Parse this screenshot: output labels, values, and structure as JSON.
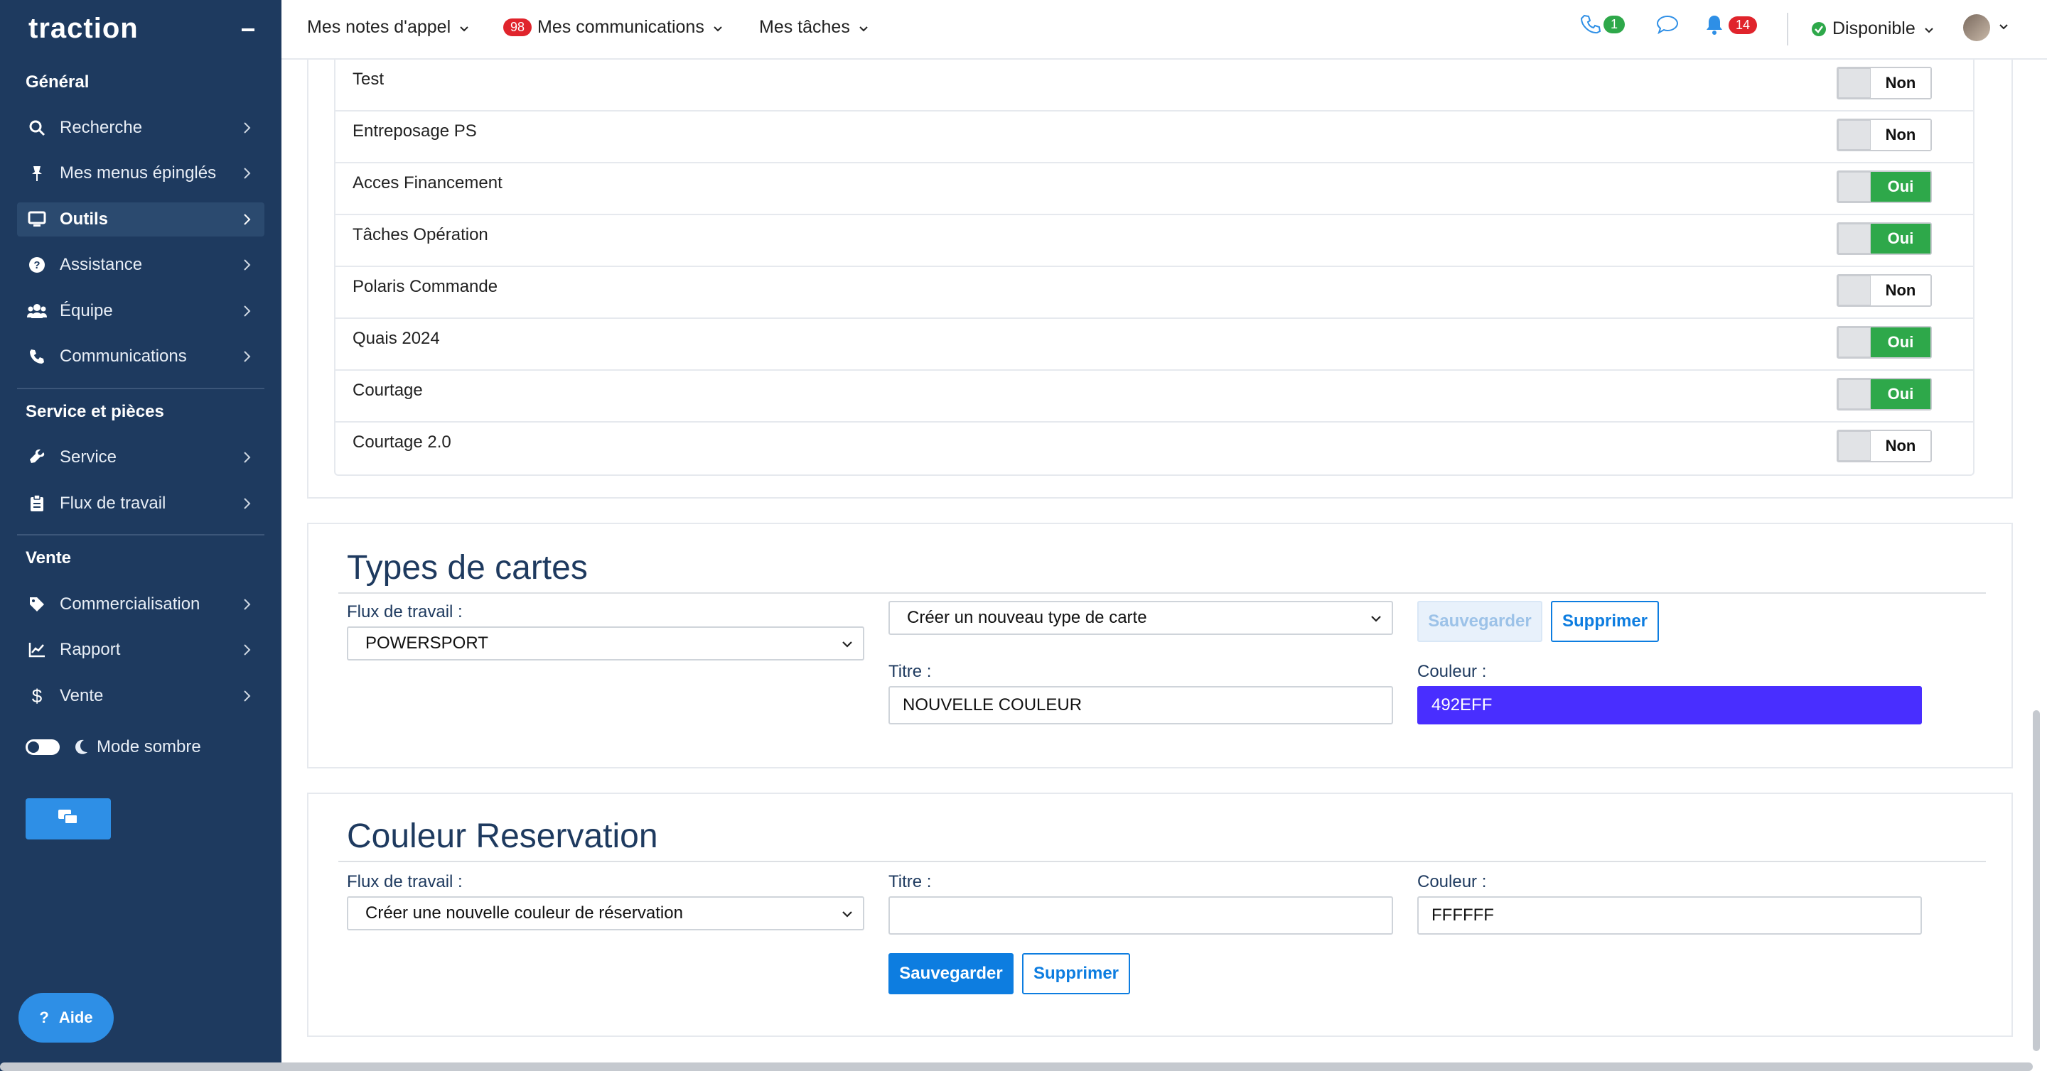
{
  "sidebar": {
    "logo": "traction",
    "sections": {
      "general": "Général",
      "service": "Service et pièces",
      "vente": "Vente"
    },
    "items": [
      {
        "label": "Recherche"
      },
      {
        "label": "Mes menus épinglés"
      },
      {
        "label": "Outils"
      },
      {
        "label": "Assistance"
      },
      {
        "label": "Équipe"
      },
      {
        "label": "Communications"
      },
      {
        "label": "Service"
      },
      {
        "label": "Flux de travail"
      },
      {
        "label": "Commercialisation"
      },
      {
        "label": "Rapport"
      },
      {
        "label": "Vente"
      }
    ],
    "dark_mode_label": "Mode sombre",
    "help_label": "Aide"
  },
  "topbar": {
    "call_notes": "Mes notes d'appel",
    "communications": "Mes communications",
    "communications_badge": "98",
    "tasks": "Mes tâches",
    "phone_badge": "1",
    "bell_badge": "14",
    "status": "Disponible"
  },
  "permissions": [
    {
      "label": "Test",
      "state": "Non"
    },
    {
      "label": "Entreposage PS",
      "state": "Non"
    },
    {
      "label": "Acces Financement",
      "state": "Oui"
    },
    {
      "label": "Tâches Opération",
      "state": "Oui"
    },
    {
      "label": "Polaris Commande",
      "state": "Non"
    },
    {
      "label": "Quais 2024",
      "state": "Oui"
    },
    {
      "label": "Courtage",
      "state": "Oui"
    },
    {
      "label": "Courtage 2.0",
      "state": "Non"
    }
  ],
  "card_types": {
    "title": "Types de cartes",
    "workflow_label": "Flux de travail :",
    "workflow_value": "POWERSPORT",
    "type_value": "Créer un nouveau type de carte",
    "save_label": "Sauvegarder",
    "delete_label": "Supprimer",
    "title_label": "Titre :",
    "title_value": "NOUVELLE COULEUR",
    "color_label": "Couleur :",
    "color_value": "492EFF",
    "color_hex": "#492eff"
  },
  "reservation": {
    "title": "Couleur Reservation",
    "workflow_label": "Flux de travail :",
    "workflow_value": "Créer une nouvelle couleur de réservation",
    "title_label": "Titre :",
    "title_value": "",
    "color_label": "Couleur :",
    "color_value": "FFFFFF",
    "save_label": "Sauvegarder",
    "delete_label": "Supprimer"
  }
}
